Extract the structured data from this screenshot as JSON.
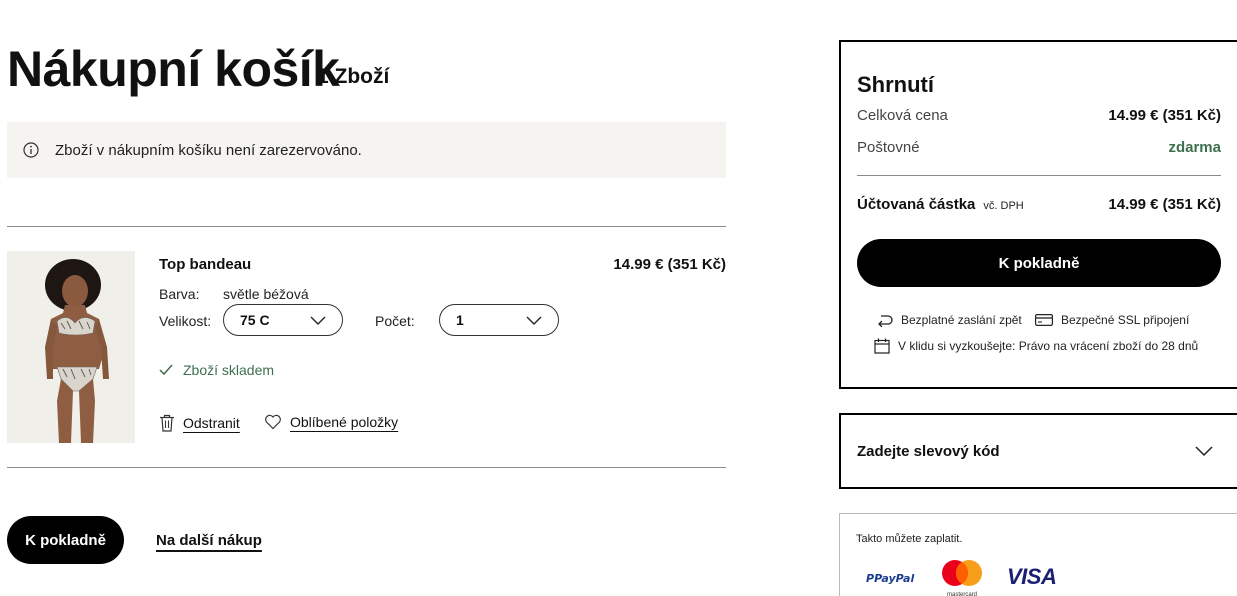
{
  "cart": {
    "title": "Nákupní košík",
    "count": "1 Zboží",
    "notice": "Zboží v nákupním košíku není zarezervováno."
  },
  "item": {
    "name": "Top bandeau",
    "price": "14.99 € (351 Kč)",
    "color_label": "Barva:",
    "color_value": "světle béžová",
    "size_label": "Velikost:",
    "size_value": "75 C",
    "qty_label": "Počet:",
    "qty_value": "1",
    "stock": "Zboží skladem",
    "remove": "Odstranit",
    "favorites": "Oblíbené položky"
  },
  "bottom": {
    "checkout": "K pokladně",
    "continue": "Na další nákup"
  },
  "summary": {
    "title": "Shrnutí",
    "total_label": "Celková cena",
    "total_value": "14.99 € (351 Kč)",
    "shipping_label": "Poštovné",
    "shipping_value": "zdarma",
    "charged_label": "Účtovaná částka",
    "vat_note": "vč. DPH",
    "charged_value": "14.99 € (351 Kč)",
    "checkout": "K pokladně",
    "trust_return": "Bezplatné zaslání zpět",
    "trust_ssl": "Bezpečné SSL připojení",
    "trust_try": "V klidu si vyzkoušejte: Právo na vrácení zboží do 28 dnů"
  },
  "discount": {
    "label": "Zadejte slevový kód"
  },
  "payment": {
    "label": "Takto můžete zaplatit.",
    "paypal": "PayPal",
    "mastercard": "mastercard",
    "visa": "VISA"
  },
  "colors": {
    "banner_bg": "#f6f4f0",
    "success_green": "#3f6f4d",
    "primary": "#000000"
  }
}
